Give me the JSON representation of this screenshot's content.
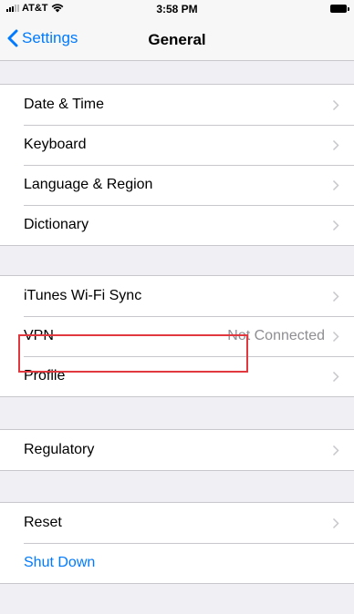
{
  "status_bar": {
    "carrier": "AT&T",
    "time": "3:58 PM",
    "icons": [
      "signal-icon",
      "wifi-icon",
      "battery-icon"
    ]
  },
  "nav": {
    "back_label": "Settings",
    "title": "General",
    "back_icon": "chevron-left-icon"
  },
  "groups": [
    {
      "rows": [
        {
          "label": "Date & Time",
          "detail": "",
          "chevron": true
        },
        {
          "label": "Keyboard",
          "detail": "",
          "chevron": true
        },
        {
          "label": "Language & Region",
          "detail": "",
          "chevron": true
        },
        {
          "label": "Dictionary",
          "detail": "",
          "chevron": true
        }
      ]
    },
    {
      "rows": [
        {
          "label": "iTunes Wi-Fi Sync",
          "detail": "",
          "chevron": true
        },
        {
          "label": "VPN",
          "detail": "Not Connected",
          "chevron": true
        },
        {
          "label": "Profile",
          "detail": "",
          "chevron": true,
          "highlighted": true
        }
      ]
    },
    {
      "rows": [
        {
          "label": "Regulatory",
          "detail": "",
          "chevron": true
        }
      ]
    },
    {
      "rows": [
        {
          "label": "Reset",
          "detail": "",
          "chevron": true
        },
        {
          "label": "Shut Down",
          "detail": "",
          "chevron": false,
          "action": true
        }
      ]
    }
  ],
  "colors": {
    "accent": "#007aff",
    "background": "#efeff4",
    "separator": "#c8c7cc",
    "secondary_text": "#8e8e93",
    "highlight_border": "#e0383e"
  }
}
